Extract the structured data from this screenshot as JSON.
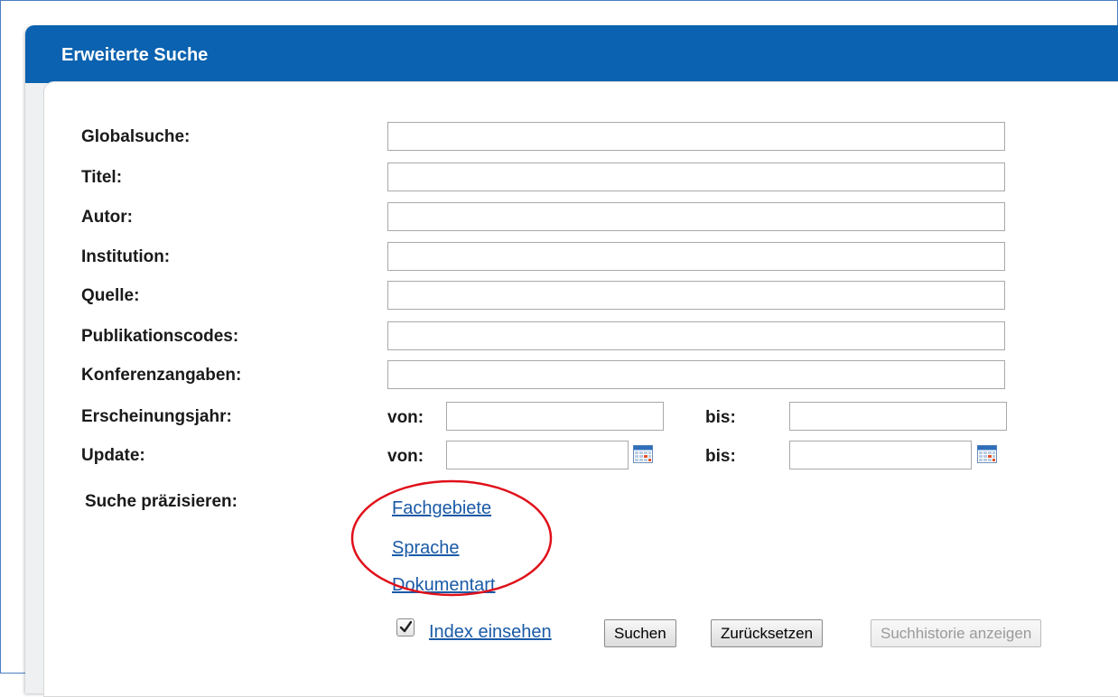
{
  "panel": {
    "title": "Erweiterte Suche"
  },
  "fields": [
    {
      "label": "Globalsuche:",
      "value": ""
    },
    {
      "label": "Titel:",
      "value": ""
    },
    {
      "label": "Autor:",
      "value": ""
    },
    {
      "label": "Institution:",
      "value": ""
    },
    {
      "label": "Quelle:",
      "value": ""
    },
    {
      "label": "Publikationscodes:",
      "value": ""
    },
    {
      "label": "Konferenzangaben:",
      "value": ""
    }
  ],
  "year_range": {
    "label": "Erscheinungsjahr:",
    "from_label": "von:",
    "to_label": "bis:",
    "from_value": "",
    "to_value": ""
  },
  "update_range": {
    "label": "Update:",
    "from_label": "von:",
    "to_label": "bis:",
    "from_value": "",
    "to_value": ""
  },
  "refine": {
    "label": "Suche präzisieren:",
    "links": [
      "Fachgebiete",
      "Sprache",
      "Dokumentart"
    ]
  },
  "actions": {
    "index_checkbox_checked": true,
    "index_link": "Index einsehen",
    "search_label": "Suchen",
    "reset_label": "Zurücksetzen",
    "history_label": "Suchhistorie anzeigen"
  },
  "colors": {
    "header": "#0a62b0",
    "link": "#1a5aa6",
    "highlight": "#e0101a"
  },
  "icons": [
    "calendar-icon",
    "checkmark-icon"
  ]
}
